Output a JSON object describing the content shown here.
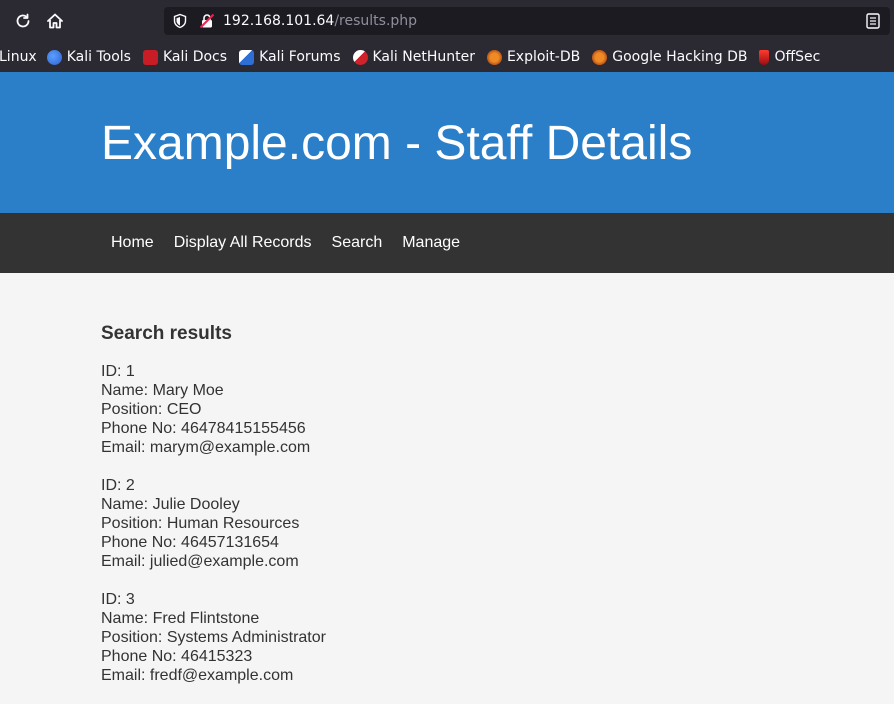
{
  "browser": {
    "url_host": "192.168.101.64",
    "url_path": "/results.php",
    "bookmarks": [
      {
        "label": "Linux",
        "icon": "kali-icon"
      },
      {
        "label": "Kali Tools",
        "icon": "kali-tools-icon"
      },
      {
        "label": "Kali Docs",
        "icon": "kali-docs-icon"
      },
      {
        "label": "Kali Forums",
        "icon": "kali-forums-icon"
      },
      {
        "label": "Kali NetHunter",
        "icon": "kali-nethunter-icon"
      },
      {
        "label": "Exploit-DB",
        "icon": "exploit-db-icon"
      },
      {
        "label": "Google Hacking DB",
        "icon": "ghdb-icon"
      },
      {
        "label": "OffSec",
        "icon": "offsec-icon"
      }
    ]
  },
  "page": {
    "title": "Example.com - Staff Details",
    "nav": [
      {
        "label": "Home"
      },
      {
        "label": "Display All Records"
      },
      {
        "label": "Search"
      },
      {
        "label": "Manage"
      }
    ],
    "results_heading": "Search results",
    "records": [
      {
        "id": "ID: 1",
        "name": "Name: Mary Moe",
        "position": "Position: CEO",
        "phone": "Phone No: 46478415155456",
        "email": "Email: marym@example.com"
      },
      {
        "id": "ID: 2",
        "name": "Name: Julie Dooley",
        "position": "Position: Human Resources",
        "phone": "Phone No: 46457131654",
        "email": "Email: julied@example.com"
      },
      {
        "id": "ID: 3",
        "name": "Name: Fred Flintstone",
        "position": "Position: Systems Administrator",
        "phone": "Phone No: 46415323",
        "email": "Email: fredf@example.com"
      }
    ]
  },
  "colors": {
    "chrome_bg": "#2b2a33",
    "urlbar_bg": "#1c1b22",
    "banner_bg": "#2b7fc8",
    "menu_bg": "#333333",
    "page_bg": "#f5f5f5"
  }
}
